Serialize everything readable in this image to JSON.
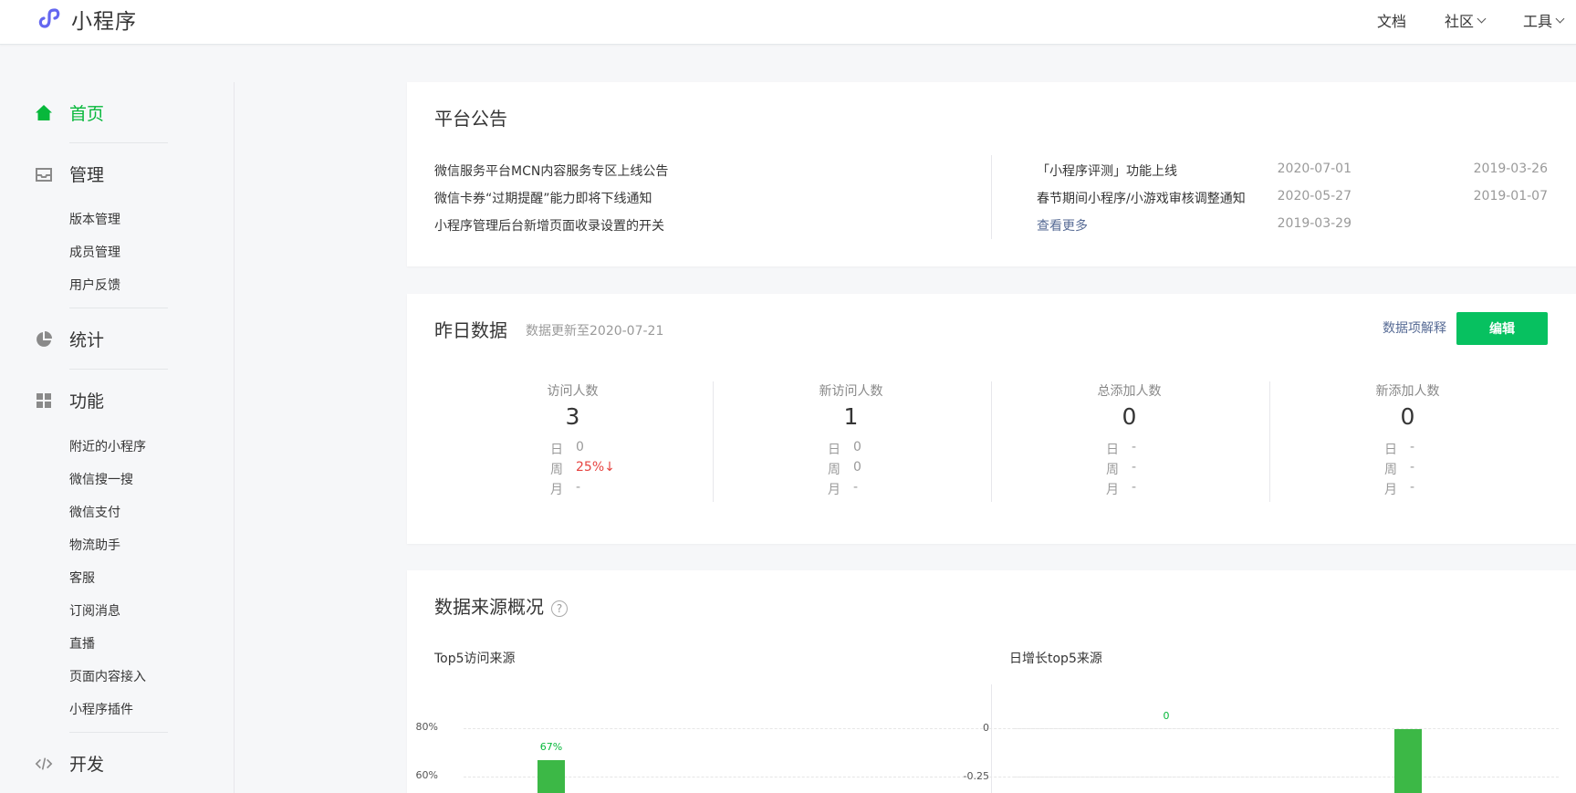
{
  "header": {
    "brand": "小程序",
    "nav": [
      {
        "label": "文档",
        "dropdown": false
      },
      {
        "label": "社区",
        "dropdown": true
      },
      {
        "label": "工具",
        "dropdown": true
      }
    ]
  },
  "sidebar": {
    "home": "首页",
    "manage": "管理",
    "manage_items": [
      "版本管理",
      "成员管理",
      "用户反馈"
    ],
    "stats": "统计",
    "features": "功能",
    "feature_items": [
      "附近的小程序",
      "微信搜一搜",
      "微信支付",
      "物流助手",
      "客服",
      "订阅消息",
      "直播",
      "页面内容接入",
      "小程序插件"
    ],
    "dev": "开发"
  },
  "notice": {
    "title": "平台公告",
    "left": [
      {
        "text": "微信服务平台MCN内容服务专区上线公告",
        "date": "2020-07-01"
      },
      {
        "text": "微信卡券“过期提醒”能力即将下线通知",
        "date": "2020-05-27"
      },
      {
        "text": "小程序管理后台新增页面收录设置的开关",
        "date": "2019-03-29"
      }
    ],
    "right": [
      {
        "text": "「小程序评测」功能上线",
        "date": "2019-03-26"
      },
      {
        "text": "春节期间小程序/小游戏审核调整通知",
        "date": "2019-01-07"
      }
    ],
    "more": "查看更多"
  },
  "yesterday": {
    "title": "昨日数据",
    "update": "数据更新至2020-07-21",
    "explain": "数据项解释",
    "edit": "编辑",
    "row_keys": {
      "day": "日",
      "week": "周",
      "month": "月"
    },
    "stats": [
      {
        "label": "访问人数",
        "value": "3",
        "day": "0",
        "week": "25%↓",
        "month": "-"
      },
      {
        "label": "新访问人数",
        "value": "1",
        "day": "0",
        "week": "0",
        "month": "-"
      },
      {
        "label": "总添加人数",
        "value": "0",
        "day": "-",
        "week": "-",
        "month": "-"
      },
      {
        "label": "新添加人数",
        "value": "0",
        "day": "-",
        "week": "-",
        "month": "-"
      }
    ]
  },
  "source": {
    "title": "数据来源概况",
    "help_glyph": "?",
    "left_title": "Top5访问来源",
    "right_title": "日增长top5来源"
  },
  "chart_data": [
    {
      "type": "bar",
      "title": "Top5访问来源",
      "y_ticks": [
        "80%",
        "60%"
      ],
      "values": [
        67
      ],
      "labels": [
        "67%"
      ],
      "ylim": [
        0,
        80
      ]
    },
    {
      "type": "bar",
      "title": "日增长top5来源",
      "y_ticks": [
        "0",
        "-0.25"
      ],
      "values": [
        0,
        0
      ],
      "labels": [
        "0"
      ]
    }
  ],
  "colors": {
    "accent": "#07c160",
    "active_menu": "#07b83b",
    "link": "#576b95",
    "bar": "#3cb846",
    "down": "#e64340"
  }
}
